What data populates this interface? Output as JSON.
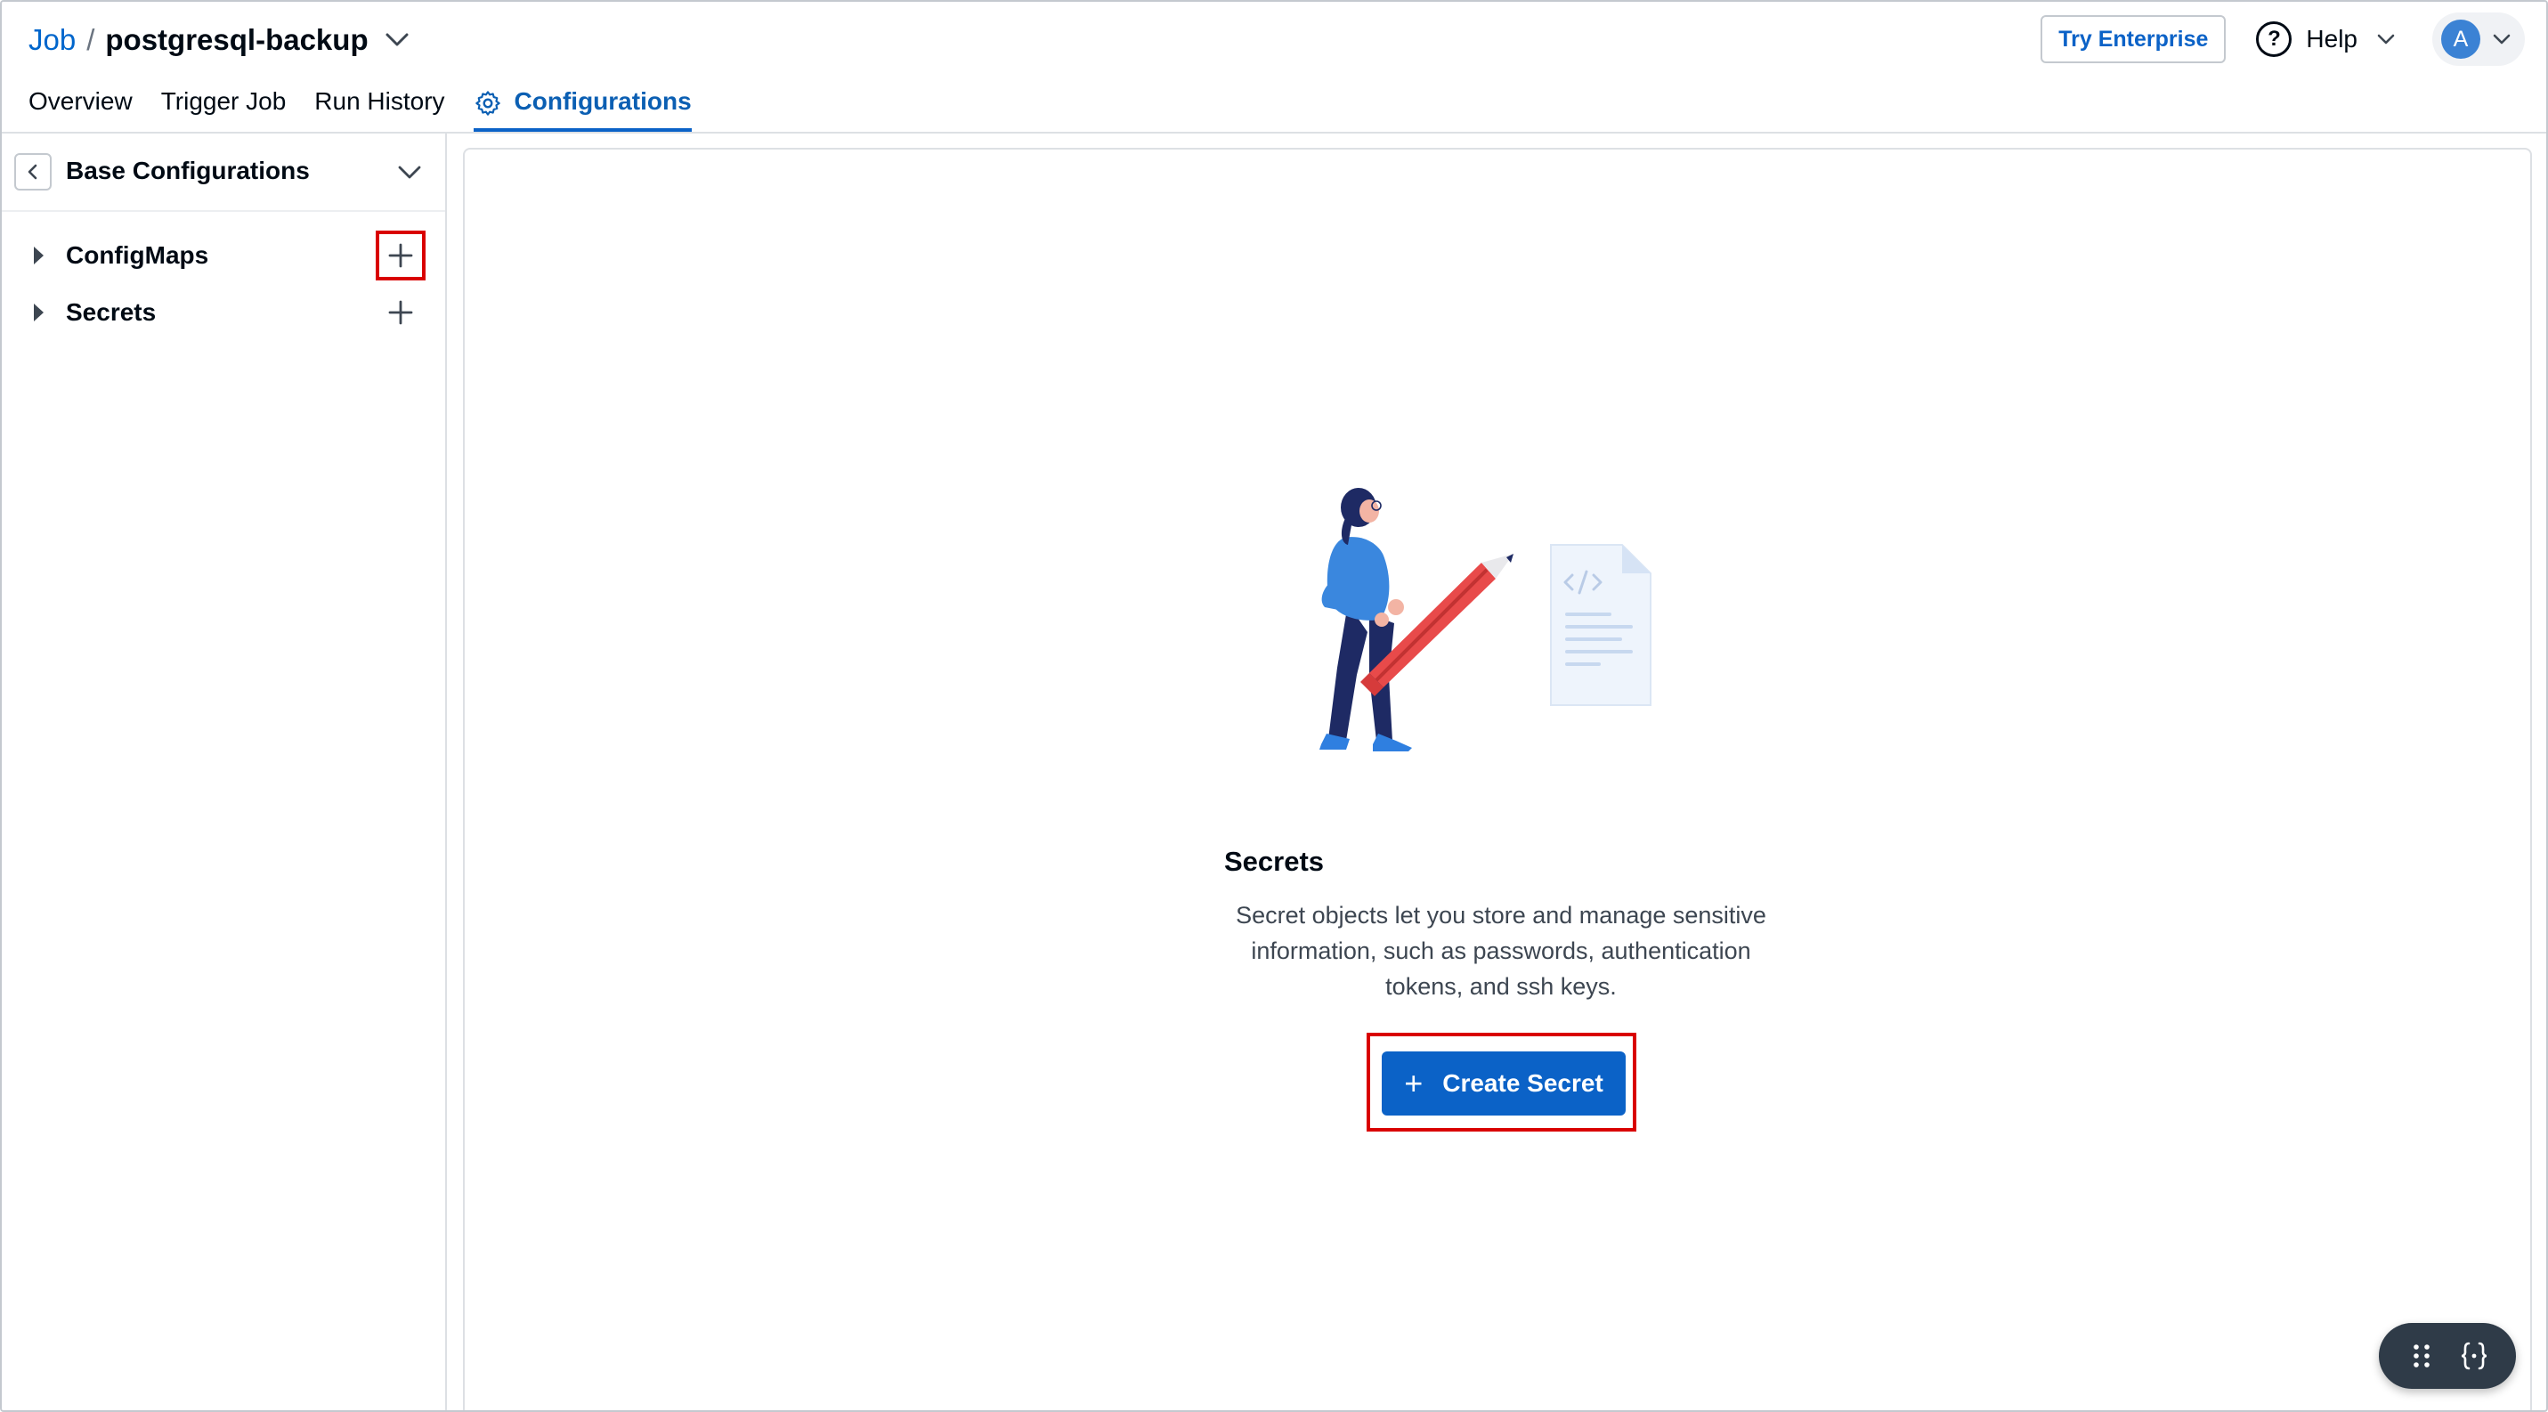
{
  "header": {
    "breadcrumb_root": "Job",
    "breadcrumb_separator": "/",
    "app_name": "postgresql-backup",
    "try_enterprise_label": "Try Enterprise",
    "help_label": "Help",
    "avatar_initial": "A"
  },
  "tabs": [
    {
      "label": "Overview",
      "active": false
    },
    {
      "label": "Trigger Job",
      "active": false
    },
    {
      "label": "Run History",
      "active": false
    },
    {
      "label": "Configurations",
      "active": true,
      "icon": "gear-icon"
    }
  ],
  "sidebar": {
    "title": "Base Configurations",
    "items": [
      {
        "label": "ConfigMaps",
        "action_icon": "plus-icon"
      },
      {
        "label": "Secrets",
        "action_icon": "plus-icon"
      }
    ]
  },
  "main": {
    "empty_state": {
      "title": "Secrets",
      "description": "Secret objects let you store and manage sensitive information, such as passwords, authentication tokens, and ssh keys.",
      "button_label": "Create Secret",
      "button_icon": "plus-icon",
      "illustration": "woman-holding-pencil-with-code-document"
    }
  },
  "colors": {
    "primary": "#0b62c7",
    "link": "#0066cc",
    "highlight_outline": "#d90000",
    "floating_bar": "#2f3b48"
  }
}
